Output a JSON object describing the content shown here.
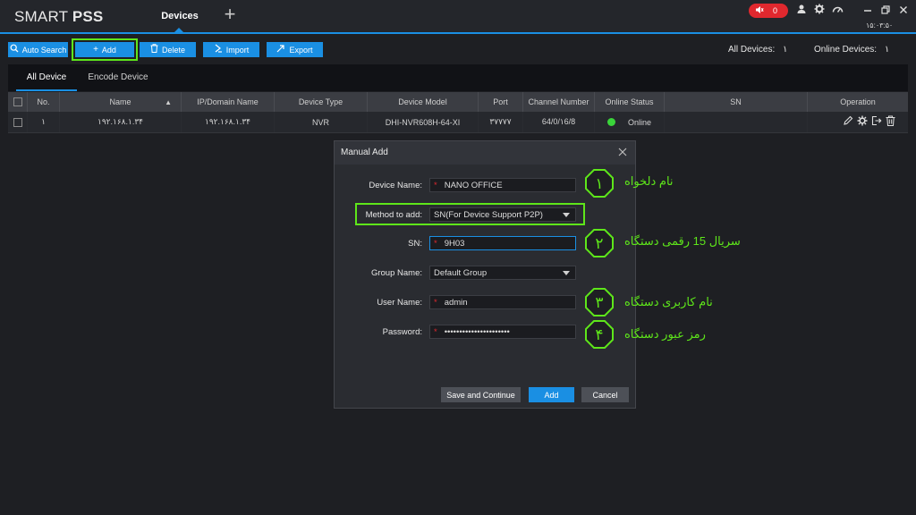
{
  "titlebar": {
    "logo_light": "SMART",
    "logo_bold": "PSS",
    "active_tab": "Devices",
    "alarm_count": "0",
    "clock": "۱۵:۰۳:۵۰"
  },
  "toolbar": {
    "auto_search": "Auto Search",
    "add": "Add",
    "delete": "Delete",
    "import": "Import",
    "export": "Export",
    "all_devices_label": "All Devices:",
    "all_devices_count": "۱",
    "online_devices_label": "Online Devices:",
    "online_devices_count": "۱"
  },
  "subtabs": [
    "All Device",
    "Encode Device"
  ],
  "table": {
    "headers": [
      "No.",
      "Name",
      "IP/Domain Name",
      "Device Type",
      "Device Model",
      "Port",
      "Channel Number",
      "Online Status",
      "SN",
      "Operation"
    ],
    "rows": [
      {
        "no": "۱",
        "name": "۱۹۲.۱۶۸.۱.۳۴",
        "ip": "۱۹۲.۱۶۸.۱.۳۴",
        "type": "NVR",
        "model": "DHI-NVR608H-64-XI",
        "port": "۳۷۷۷۷",
        "channels": "64/0/۱6/8",
        "status": "Online",
        "sn": ""
      }
    ]
  },
  "modal": {
    "title": "Manual Add",
    "fields": {
      "device_name_label": "Device Name:",
      "device_name_value": "NANO OFFICE",
      "method_label": "Method to add:",
      "method_value": "SN(For Device Support P2P)",
      "sn_label": "SN:",
      "sn_value": "9H03",
      "group_label": "Group Name:",
      "group_value": "Default Group",
      "user_label": "User Name:",
      "user_value": "admin",
      "password_label": "Password:",
      "password_value": "••••••••••••••••••••••"
    },
    "buttons": {
      "save_continue": "Save and Continue",
      "add": "Add",
      "cancel": "Cancel"
    }
  },
  "annotations": [
    {
      "num": "۱",
      "text": "نام دلخواه"
    },
    {
      "num": "۲",
      "text": "سریال 15 رقمی دستگاه"
    },
    {
      "num": "۳",
      "text": "نام کاربری دستگاه"
    },
    {
      "num": "۴",
      "text": "رمز عبور دستگاه"
    }
  ],
  "colors": {
    "accent": "#1a8fe3",
    "highlight": "#5ee61a",
    "alarm": "#e0282e",
    "online": "#3ad43a"
  }
}
